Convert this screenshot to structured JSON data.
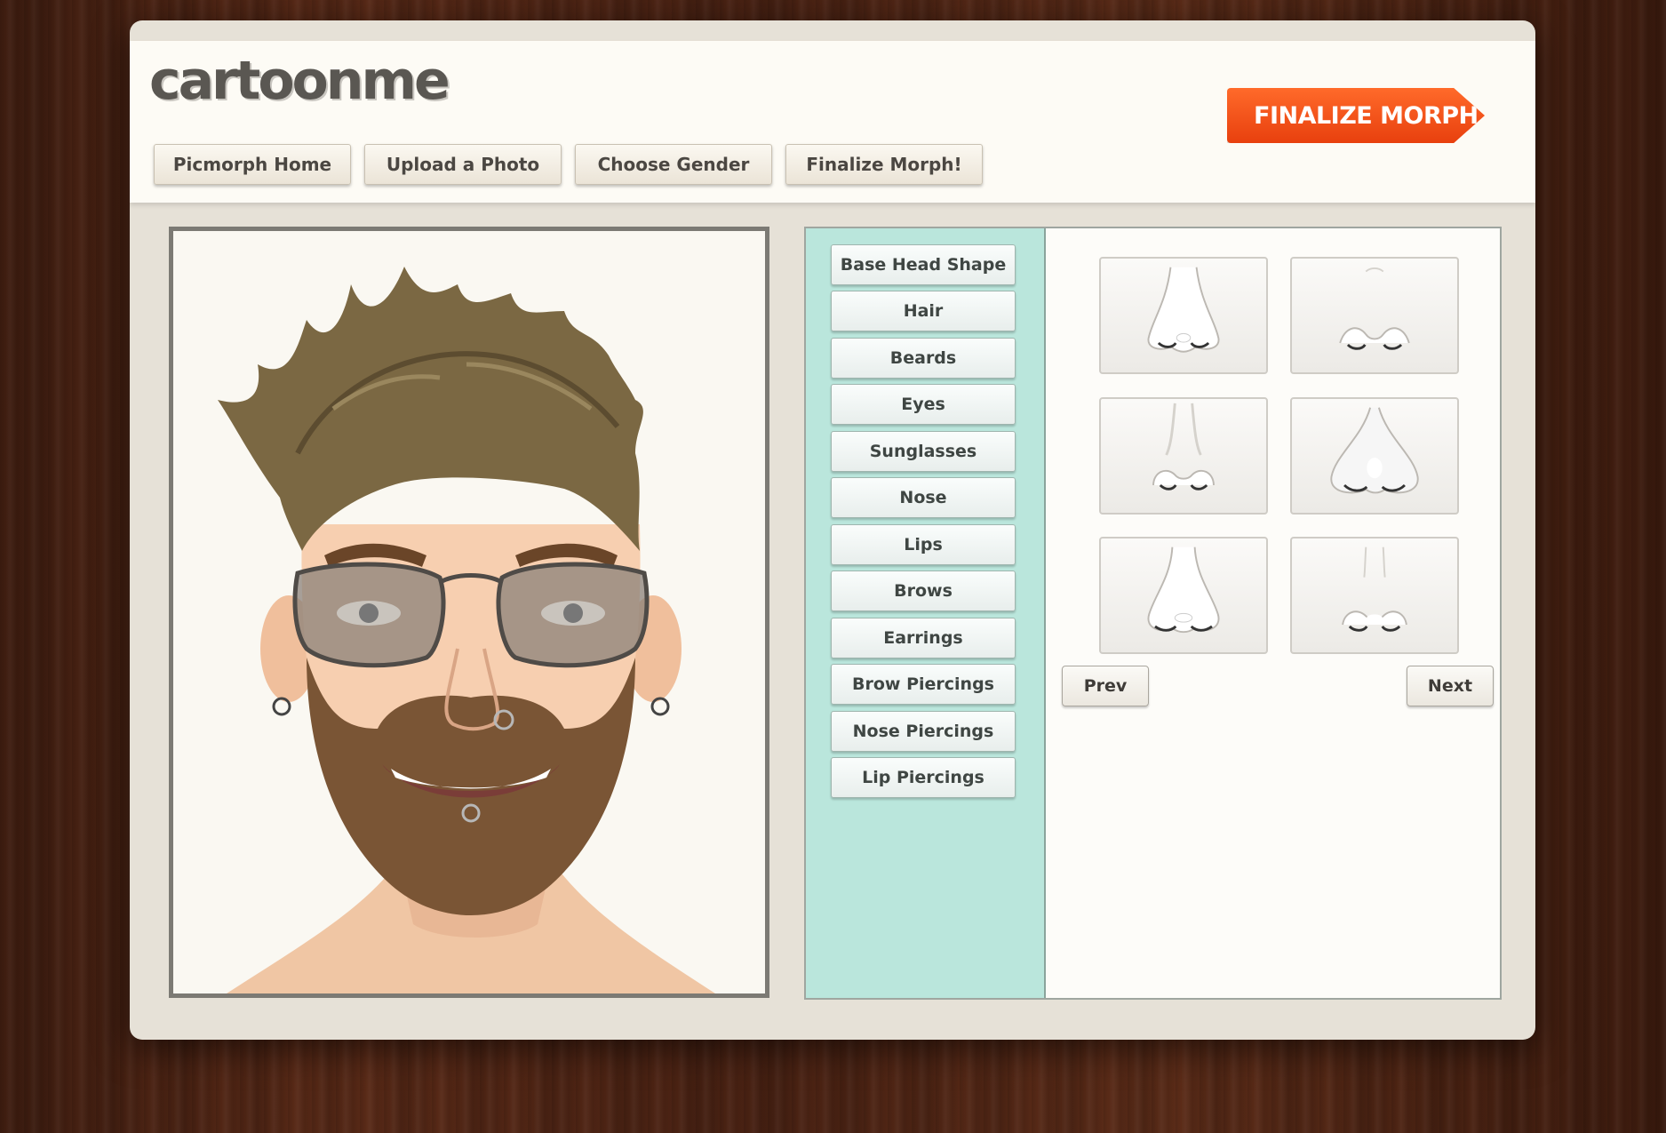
{
  "app": {
    "logo": "cartoonme",
    "finalize_cta": "FINALIZE MORPH",
    "accent_color": "#f04e14"
  },
  "nav": {
    "items": [
      {
        "label": "Picmorph Home"
      },
      {
        "label": "Upload a Photo"
      },
      {
        "label": "Choose Gender"
      },
      {
        "label": "Finalize Morph!"
      }
    ]
  },
  "categories": {
    "items": [
      {
        "label": "Base Head Shape"
      },
      {
        "label": "Hair"
      },
      {
        "label": "Beards"
      },
      {
        "label": "Eyes"
      },
      {
        "label": "Sunglasses"
      },
      {
        "label": "Nose"
      },
      {
        "label": "Lips"
      },
      {
        "label": "Brows"
      },
      {
        "label": "Earrings"
      },
      {
        "label": "Brow Piercings"
      },
      {
        "label": "Nose Piercings"
      },
      {
        "label": "Lip Piercings"
      }
    ],
    "panel_color": "#bae6dc"
  },
  "options": {
    "icon": "nose-option-icon",
    "count": 6
  },
  "pager": {
    "prev_label": "Prev",
    "next_label": "Next"
  }
}
